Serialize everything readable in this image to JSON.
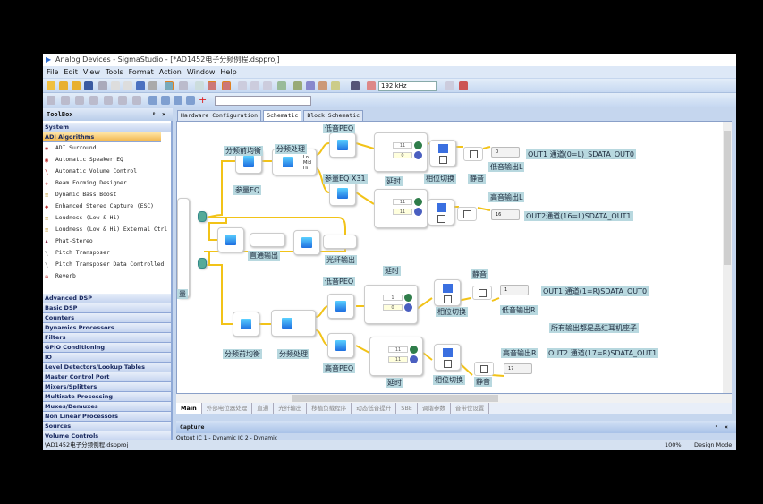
{
  "title": "Analog Devices - SigmaStudio - [*AD1452电子分频例程.dspproj]",
  "menu": [
    "File",
    "Edit",
    "View",
    "Tools",
    "Format",
    "Action",
    "Window",
    "Help"
  ],
  "toolbar": {
    "sample_rate": "192 kHz"
  },
  "toolbox": {
    "title": "ToolBox",
    "pin": "ᵖ",
    "close": "×",
    "system": "System",
    "adi": "ADI Algorithms",
    "tools": [
      "ADI Surround",
      "Automatic Speaker EQ",
      "Automatic Volume Control",
      "Beam Forming Designer",
      "Dynamic Bass Boost",
      "Enhanced Stereo Capture (ESC)",
      "Loudness (Low & Hi)",
      "Loudness (Low & Hi) External Ctrl",
      "Phat-Stereo",
      "Pitch Transposer",
      "Pitch Transposer Data Controlled",
      "Reverb"
    ],
    "categories": [
      "Advanced DSP",
      "Basic DSP",
      "Counters",
      "Dynamics Processors",
      "Filters",
      "GPIO Conditioning",
      "IO",
      "Level Detectors/Lookup Tables",
      "Master Control Port",
      "Mixers/Splitters",
      "Multirate Processing",
      "Muxes/Demuxes",
      "Non Linear Processors",
      "Sources",
      "Volume Controls"
    ]
  },
  "tabs": [
    "Hardware Configuration",
    "Schematic",
    "Block Schematic"
  ],
  "schematic": {
    "labels": {
      "bass_peq_l": "低音PEQ",
      "pre_eq_l": "分频前均衡",
      "xover_l": "分频处理",
      "param_eq": "参量EQ",
      "param_eq_x31": "参量EQ X31",
      "delay_l": "延时",
      "phase_l": "相位切换",
      "mute_l": "静音",
      "bass_out_l": "低音输出L",
      "out1_l": "OUT1 通道(0=L)_SDATA_OUT0",
      "treble_out_l": "高音输出L",
      "out2_l": "OUT2通道(16=L)SDATA_OUT1",
      "passthru": "直通输出",
      "optical": "光纤输出",
      "delay_r": "延时",
      "bass_peq_r": "低音PEQ",
      "mute_r": "静音",
      "out1_r": "OUT1 通道(1=R)SDATA_OUT0",
      "bass_out_r": "低音输出R",
      "note": "所有输出都是品红耳机座子",
      "treble_out_r": "高音输出R",
      "out2_r": "OUT2 通道(17=R)SDATA_OUT1",
      "pre_eq_r": "分频前均衡",
      "xover_r": "分频处理",
      "treble_peq_r": "高音PEQ",
      "delay_r2": "延时",
      "phase_r2": "相位切换",
      "mute_r2": "静音",
      "vol": "量",
      "xover_ports": "Lo Mid Hi"
    },
    "delays": [
      {
        "max": "11",
        "cur": "0"
      },
      {
        "max": "11",
        "cur": "11"
      },
      {
        "max": "1",
        "cur": "0"
      },
      {
        "max": "11",
        "cur": "11"
      }
    ],
    "outputs": [
      "0",
      "16",
      "1",
      "17"
    ]
  },
  "bottom_tabs": [
    "Main",
    "外部电位器处理",
    "直通",
    "光纤输出",
    "移植负载程序",
    "动态低音提升",
    "SBE",
    "调谐参数",
    "音带位设置"
  ],
  "capture": {
    "title": "Capture",
    "tabs": [
      "Output",
      "IC 1 - Dynamic",
      "IC 2 - Dynamic"
    ]
  },
  "status": {
    "file": "\\AD1452电子分频例程.dspproj",
    "zoom": "100%",
    "mode": "Design Mode"
  }
}
